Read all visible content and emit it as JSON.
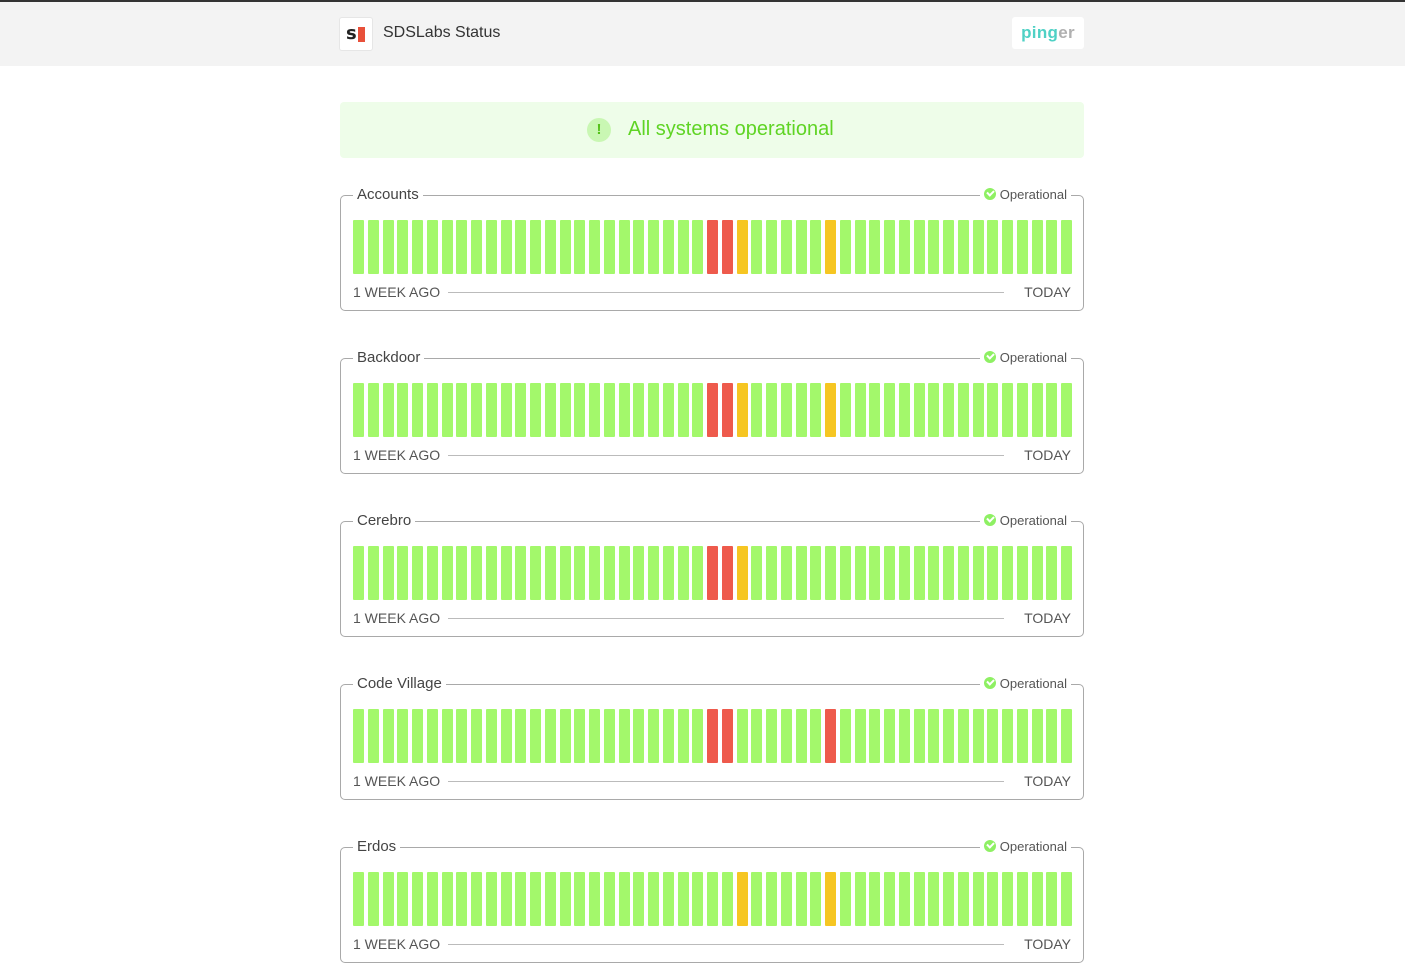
{
  "header": {
    "logo_letter": "s",
    "title": "SDSLabs Status",
    "pinger": {
      "part1": "ping",
      "part2": "er"
    }
  },
  "banner": {
    "icon": "exclamation-icon",
    "glyph": "!",
    "text": "All systems operational"
  },
  "colors": {
    "up": "#a3f86b",
    "down": "#ee5a4c",
    "partial": "#f6c622"
  },
  "labels": {
    "start": "1 WEEK AGO",
    "end": "TODAY"
  },
  "services": [
    {
      "name": "Accounts",
      "status": "Operational",
      "bars": "GGGGGGGGGGGGGGGGGGGGGGGGRRYGGGGGYGGGGGGGGGGGGGGGG"
    },
    {
      "name": "Backdoor",
      "status": "Operational",
      "bars": "GGGGGGGGGGGGGGGGGGGGGGGGRRYGGGGGYGGGGGGGGGGGGGGGG"
    },
    {
      "name": "Cerebro",
      "status": "Operational",
      "bars": "GGGGGGGGGGGGGGGGGGGGGGGGRRYGGGGGGGGGGGGGGGGGGGGGG"
    },
    {
      "name": "Code Village",
      "status": "Operational",
      "bars": "GGGGGGGGGGGGGGGGGGGGGGGGRRGGGGGGRGGGGGGGGGGGGGGGG"
    },
    {
      "name": "Erdos",
      "status": "Operational",
      "bars": "GGGGGGGGGGGGGGGGGGGGGGGGGGYGGGGGYGGGGGGGGGGGGGGGG"
    }
  ]
}
